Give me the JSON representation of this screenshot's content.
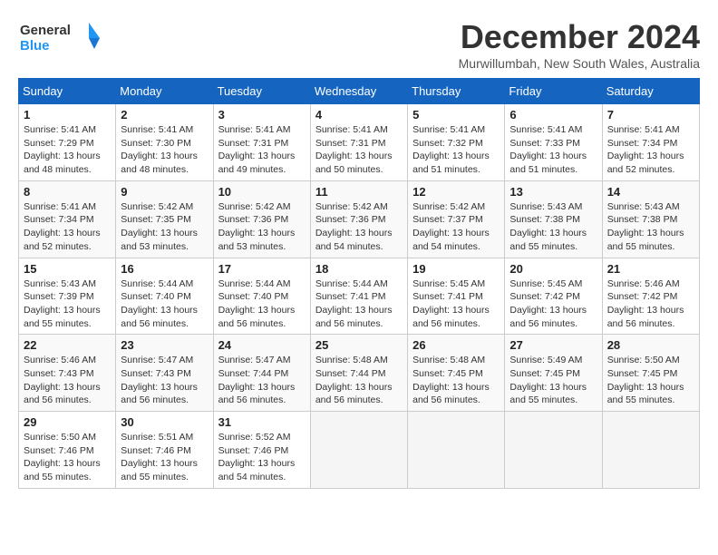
{
  "header": {
    "logo_line1": "General",
    "logo_line2": "Blue",
    "title": "December 2024",
    "subtitle": "Murwillumbah, New South Wales, Australia"
  },
  "weekdays": [
    "Sunday",
    "Monday",
    "Tuesday",
    "Wednesday",
    "Thursday",
    "Friday",
    "Saturday"
  ],
  "weeks": [
    [
      {
        "day": "1",
        "info": "Sunrise: 5:41 AM\nSunset: 7:29 PM\nDaylight: 13 hours\nand 48 minutes."
      },
      {
        "day": "2",
        "info": "Sunrise: 5:41 AM\nSunset: 7:30 PM\nDaylight: 13 hours\nand 48 minutes."
      },
      {
        "day": "3",
        "info": "Sunrise: 5:41 AM\nSunset: 7:31 PM\nDaylight: 13 hours\nand 49 minutes."
      },
      {
        "day": "4",
        "info": "Sunrise: 5:41 AM\nSunset: 7:31 PM\nDaylight: 13 hours\nand 50 minutes."
      },
      {
        "day": "5",
        "info": "Sunrise: 5:41 AM\nSunset: 7:32 PM\nDaylight: 13 hours\nand 51 minutes."
      },
      {
        "day": "6",
        "info": "Sunrise: 5:41 AM\nSunset: 7:33 PM\nDaylight: 13 hours\nand 51 minutes."
      },
      {
        "day": "7",
        "info": "Sunrise: 5:41 AM\nSunset: 7:34 PM\nDaylight: 13 hours\nand 52 minutes."
      }
    ],
    [
      {
        "day": "8",
        "info": "Sunrise: 5:41 AM\nSunset: 7:34 PM\nDaylight: 13 hours\nand 52 minutes."
      },
      {
        "day": "9",
        "info": "Sunrise: 5:42 AM\nSunset: 7:35 PM\nDaylight: 13 hours\nand 53 minutes."
      },
      {
        "day": "10",
        "info": "Sunrise: 5:42 AM\nSunset: 7:36 PM\nDaylight: 13 hours\nand 53 minutes."
      },
      {
        "day": "11",
        "info": "Sunrise: 5:42 AM\nSunset: 7:36 PM\nDaylight: 13 hours\nand 54 minutes."
      },
      {
        "day": "12",
        "info": "Sunrise: 5:42 AM\nSunset: 7:37 PM\nDaylight: 13 hours\nand 54 minutes."
      },
      {
        "day": "13",
        "info": "Sunrise: 5:43 AM\nSunset: 7:38 PM\nDaylight: 13 hours\nand 55 minutes."
      },
      {
        "day": "14",
        "info": "Sunrise: 5:43 AM\nSunset: 7:38 PM\nDaylight: 13 hours\nand 55 minutes."
      }
    ],
    [
      {
        "day": "15",
        "info": "Sunrise: 5:43 AM\nSunset: 7:39 PM\nDaylight: 13 hours\nand 55 minutes."
      },
      {
        "day": "16",
        "info": "Sunrise: 5:44 AM\nSunset: 7:40 PM\nDaylight: 13 hours\nand 56 minutes."
      },
      {
        "day": "17",
        "info": "Sunrise: 5:44 AM\nSunset: 7:40 PM\nDaylight: 13 hours\nand 56 minutes."
      },
      {
        "day": "18",
        "info": "Sunrise: 5:44 AM\nSunset: 7:41 PM\nDaylight: 13 hours\nand 56 minutes."
      },
      {
        "day": "19",
        "info": "Sunrise: 5:45 AM\nSunset: 7:41 PM\nDaylight: 13 hours\nand 56 minutes."
      },
      {
        "day": "20",
        "info": "Sunrise: 5:45 AM\nSunset: 7:42 PM\nDaylight: 13 hours\nand 56 minutes."
      },
      {
        "day": "21",
        "info": "Sunrise: 5:46 AM\nSunset: 7:42 PM\nDaylight: 13 hours\nand 56 minutes."
      }
    ],
    [
      {
        "day": "22",
        "info": "Sunrise: 5:46 AM\nSunset: 7:43 PM\nDaylight: 13 hours\nand 56 minutes."
      },
      {
        "day": "23",
        "info": "Sunrise: 5:47 AM\nSunset: 7:43 PM\nDaylight: 13 hours\nand 56 minutes."
      },
      {
        "day": "24",
        "info": "Sunrise: 5:47 AM\nSunset: 7:44 PM\nDaylight: 13 hours\nand 56 minutes."
      },
      {
        "day": "25",
        "info": "Sunrise: 5:48 AM\nSunset: 7:44 PM\nDaylight: 13 hours\nand 56 minutes."
      },
      {
        "day": "26",
        "info": "Sunrise: 5:48 AM\nSunset: 7:45 PM\nDaylight: 13 hours\nand 56 minutes."
      },
      {
        "day": "27",
        "info": "Sunrise: 5:49 AM\nSunset: 7:45 PM\nDaylight: 13 hours\nand 55 minutes."
      },
      {
        "day": "28",
        "info": "Sunrise: 5:50 AM\nSunset: 7:45 PM\nDaylight: 13 hours\nand 55 minutes."
      }
    ],
    [
      {
        "day": "29",
        "info": "Sunrise: 5:50 AM\nSunset: 7:46 PM\nDaylight: 13 hours\nand 55 minutes."
      },
      {
        "day": "30",
        "info": "Sunrise: 5:51 AM\nSunset: 7:46 PM\nDaylight: 13 hours\nand 55 minutes."
      },
      {
        "day": "31",
        "info": "Sunrise: 5:52 AM\nSunset: 7:46 PM\nDaylight: 13 hours\nand 54 minutes."
      },
      null,
      null,
      null,
      null
    ]
  ]
}
